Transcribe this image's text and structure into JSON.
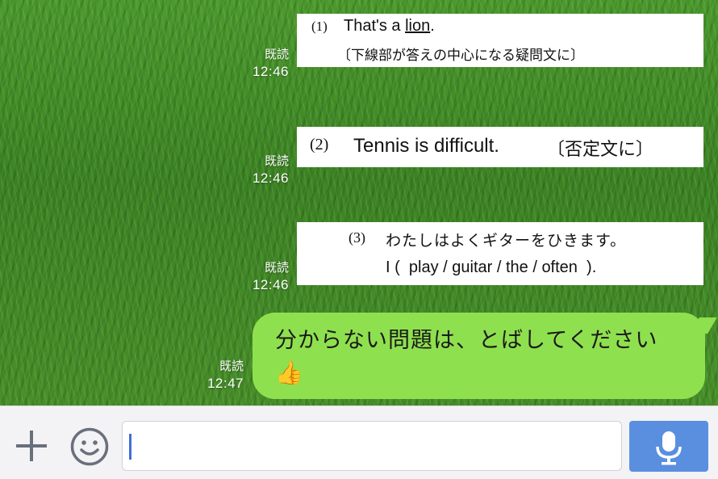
{
  "messages": [
    {
      "read": "既読",
      "time": "12:46",
      "image": {
        "number": "(1)",
        "sentence_pre": "That's a ",
        "sentence_underlined": "lion",
        "sentence_post": ".",
        "instruction": "〔下線部が答えの中心になる疑問文に〕"
      }
    },
    {
      "read": "既読",
      "time": "12:46",
      "image": {
        "number": "(2)",
        "sentence": "Tennis is difficult.",
        "instruction": "〔否定文に〕"
      }
    },
    {
      "read": "既読",
      "time": "12:46",
      "image": {
        "number": "(3)",
        "line1": "わたしはよくギターをひきます。",
        "line2_pre": "I (",
        "line2_words": "play / guitar / the / often",
        "line2_post": ")."
      }
    },
    {
      "read": "既読",
      "time": "12:47",
      "text": "分からない問題は、とばしてください",
      "emoji": "👍"
    }
  ],
  "input": {
    "placeholder": ""
  },
  "icons": {
    "add": "plus-icon",
    "emoji": "smiley-icon",
    "voice": "microphone-icon"
  },
  "colors": {
    "bubble": "#8fe04e",
    "accent": "#5a8fe0"
  }
}
